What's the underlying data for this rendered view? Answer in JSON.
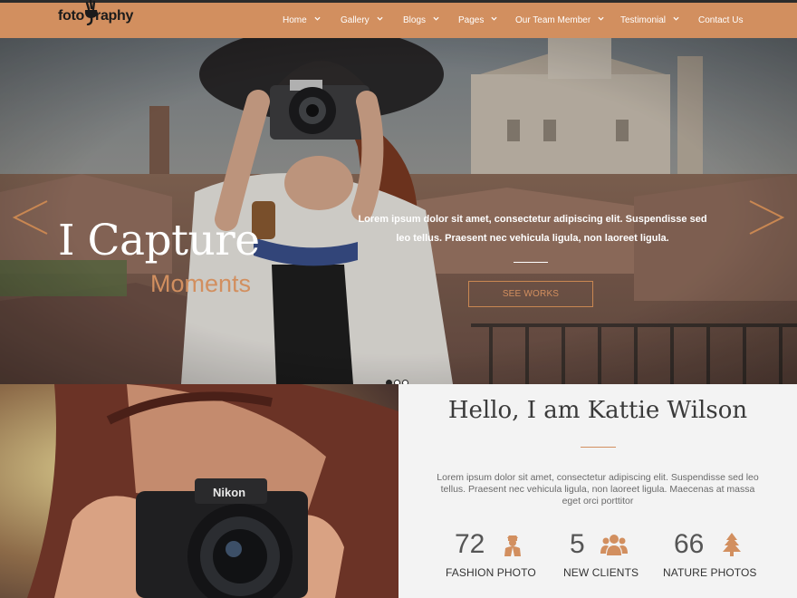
{
  "brand": {
    "logo_text": "foto raphy"
  },
  "nav": {
    "items": [
      {
        "label": "Home"
      },
      {
        "label": "Gallery"
      },
      {
        "label": "Blogs"
      },
      {
        "label": "Pages"
      },
      {
        "label": "Our Team Member"
      },
      {
        "label": "Testimonial"
      },
      {
        "label": "Contact Us"
      }
    ]
  },
  "hero": {
    "title": "I Capture",
    "subtitle": "Moments",
    "text": "Lorem ipsum dolor sit amet, consectetur adipiscing elit. Suspendisse sed leo tellus. Praesent nec vehicula ligula, non laoreet ligula.",
    "button_label": "SEE WORKS",
    "slides": 3,
    "active_slide": 1
  },
  "about": {
    "title": "Hello, I am Kattie Wilson",
    "text": "Lorem ipsum dolor sit amet, consectetur adipiscing elit. Suspendisse sed leo tellus. Praesent nec vehicula ligula, non laoreet ligula. Maecenas at massa eget orci porttitor",
    "stats": [
      {
        "number": "72",
        "label": "FASHION PHOTO",
        "icon": "person-icon"
      },
      {
        "number": "5",
        "label": "NEW CLIENTS",
        "icon": "group-icon"
      },
      {
        "number": "66",
        "label": "NATURE PHOTOS",
        "icon": "tree-icon"
      }
    ]
  },
  "colors": {
    "accent": "#d28f5f",
    "header_bg": "#d28f5f",
    "about_bg": "#f3f3f3"
  }
}
